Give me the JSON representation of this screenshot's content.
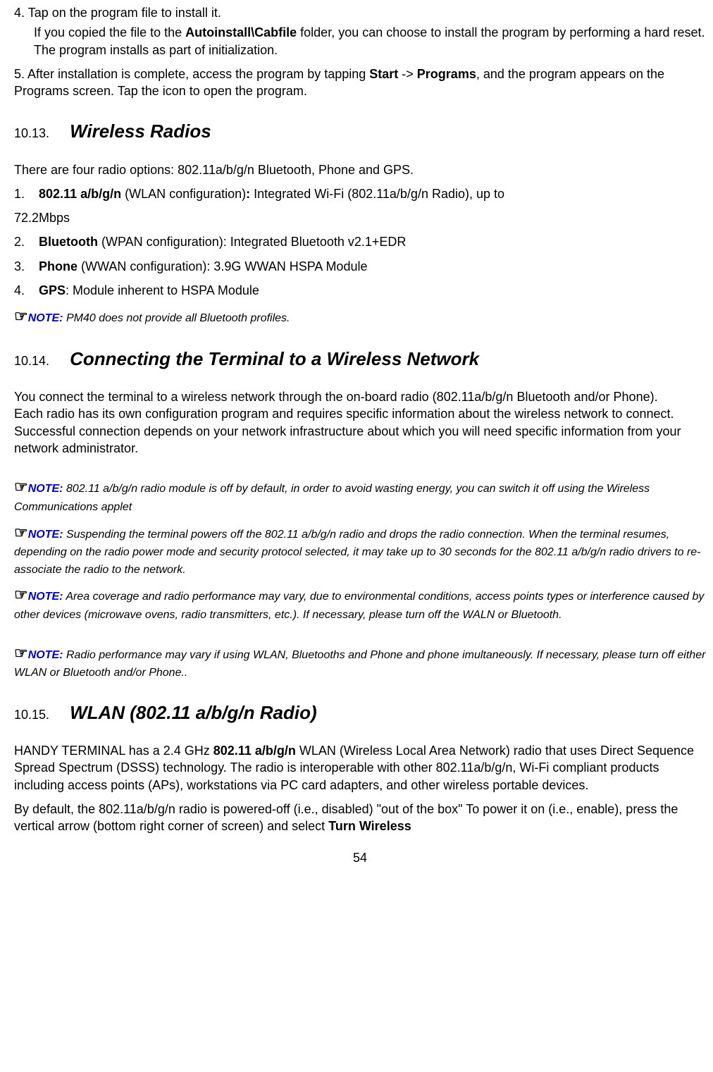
{
  "step4": {
    "line1": "4. Tap on the program file to install it.",
    "line2a": "If you copied the file to the ",
    "bold": "Autoinstall\\Cabfile",
    "line2b": " folder, you can choose to install the program by performing a hard reset. The program installs as part of initialization."
  },
  "step5": {
    "a": "5. After installation is complete, access the program by tapping ",
    "b1": "Start",
    "arrow": " -> ",
    "b2": "Programs",
    "c": ", and the program appears on the Programs screen. Tap the icon to open the program."
  },
  "s1013": {
    "num": "10.13.",
    "title": "Wireless Radios",
    "intro": "There are four radio options: 802.11a/b/g/n Bluetooth, Phone and GPS.",
    "item1": {
      "n": "1.",
      "b": "802.11 a/b/g/n",
      "a": " (WLAN configuration)",
      "colon": ":",
      "t": " Integrated Wi-Fi (802.11a/b/g/n Radio), up to"
    },
    "item1b": "72.2Mbps",
    "item2": {
      "n": "2.",
      "b": "Bluetooth",
      "t": " (WPAN configuration): Integrated Bluetooth v2.1+EDR"
    },
    "item3": {
      "n": "3.",
      "b": "Phone",
      "t": " (WWAN configuration): 3.9G WWAN HSPA Module"
    },
    "item4": {
      "n": "4.",
      "b": "GPS",
      "t": ": Module inherent to HSPA Module"
    },
    "note": {
      "icon": "☞",
      "label": "NOTE:",
      "text": " PM40 does not provide all Bluetooth profiles."
    }
  },
  "s1014": {
    "num": "10.14.",
    "title": "Connecting the Terminal to a Wireless Network",
    "p1": "You connect the terminal to a wireless network through the on-board radio (802.11a/b/g/n Bluetooth and/or Phone).",
    "p2": "Each radio has its own configuration program and requires specific information about the wireless network to connect. Successful connection depends on your network infrastructure about which you will need specific information from your network administrator.",
    "n1": {
      "icon": "☞",
      "label": "NOTE:",
      "text": " 802.11 a/b/g/n radio module is off by default, in order to avoid wasting energy, you can switch it off using the Wireless Communications applet"
    },
    "n2": {
      "icon": "☞",
      "label": "NOTE:",
      "text": " Suspending the terminal powers off the 802.11 a/b/g/n radio and drops the radio connection. When the terminal resumes, depending on the radio power mode and security protocol selected, it may take up to 30 seconds for the 802.11 a/b/g/n radio drivers to re-associate the radio to the network."
    },
    "n3": {
      "icon": "☞",
      "label": "NOTE:",
      "text": " Area coverage and radio performance may vary, due to environmental conditions, access points types or interference caused by other devices (microwave ovens, radio transmitters, etc.). If necessary, please turn off the WALN or Bluetooth."
    },
    "n4": {
      "icon": "☞",
      "label": "NOTE:",
      "text": " Radio performance may vary if using WLAN, Bluetooths and Phone and phone imultaneously. If necessary, please turn off either WLAN or Bluetooth and/or Phone.."
    }
  },
  "s1015": {
    "num": "10.15.",
    "title": "WLAN (802.11 a/b/g/n Radio)",
    "p1a": "HANDY TERMINAL has a 2.4 GHz ",
    "p1b": "802.11 a/b/g/n",
    "p1c": " WLAN (Wireless Local Area Network) radio that uses Direct Sequence Spread Spectrum (DSSS) technology. The radio is interoperable with other 802.11a/b/g/n, Wi-Fi compliant products including access points (APs), workstations via PC card adapters, and other wireless portable devices.",
    "p2a": "By default, the 802.11a/b/g/n radio is powered-off (i.e., disabled) \"out of the box\" To power it on (i.e., enable), press the vertical arrow (bottom right corner of screen) and select ",
    "p2b": "Turn Wireless"
  },
  "page": "54"
}
